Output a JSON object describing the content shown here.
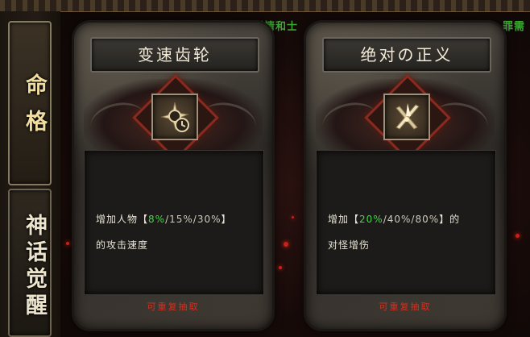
{
  "header": {
    "marquee_text": "动剧情和士",
    "marquee_tail": "罪需"
  },
  "tabs": [
    {
      "label": "命格",
      "active": true
    },
    {
      "label": "神话觉醒",
      "active": false
    }
  ],
  "cards": [
    {
      "title": "变速齿轮",
      "icon": "gear-clock-icon",
      "desc_prefix": "增加人物【",
      "value_current": "8%",
      "value_rest": "/15%/30%",
      "desc_suffix": "】",
      "desc_line2": "的攻击速度",
      "reroll_label": "可重复抽取"
    },
    {
      "title": "绝对の正义",
      "icon": "crossed-swords-icon",
      "desc_prefix": "增加【",
      "value_current": "20%",
      "value_rest": "/40%/80%",
      "desc_suffix": "】的",
      "desc_line2": "对怪增伤",
      "reroll_label": "可重复抽取"
    }
  ],
  "colors": {
    "highlight_green": "#46d24a",
    "reroll_red": "#d3311f",
    "tab_gold": "#f2dda0"
  }
}
